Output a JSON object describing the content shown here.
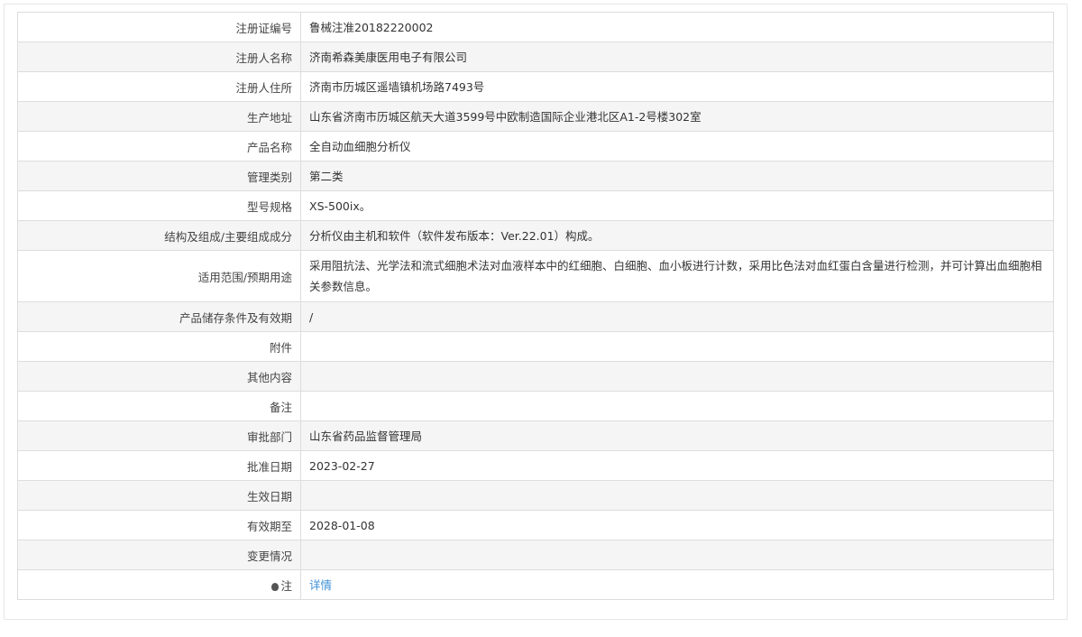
{
  "rows": [
    {
      "label": "注册证编号",
      "value": "鲁械注准20182220002"
    },
    {
      "label": "注册人名称",
      "value": "济南希森美康医用电子有限公司"
    },
    {
      "label": "注册人住所",
      "value": "济南市历城区遥墙镇机场路7493号"
    },
    {
      "label": "生产地址",
      "value": "山东省济南市历城区航天大道3599号中欧制造国际企业港北区A1-2号楼302室"
    },
    {
      "label": "产品名称",
      "value": "全自动血细胞分析仪"
    },
    {
      "label": "管理类别",
      "value": "第二类"
    },
    {
      "label": "型号规格",
      "value": "XS-500ix。"
    },
    {
      "label": "结构及组成/主要组成成分",
      "value": "分析仪由主机和软件（软件发布版本：Ver.22.01）构成。"
    },
    {
      "label": "适用范围/预期用途",
      "value": "采用阻抗法、光学法和流式细胞术法对血液样本中的红细胞、白细胞、血小板进行计数，采用比色法对血红蛋白含量进行检测，并可计算出血细胞相关参数信息。"
    },
    {
      "label": "产品储存条件及有效期",
      "value": "/"
    },
    {
      "label": "附件",
      "value": ""
    },
    {
      "label": "其他内容",
      "value": ""
    },
    {
      "label": "备注",
      "value": ""
    },
    {
      "label": "审批部门",
      "value": "山东省药品监督管理局"
    },
    {
      "label": "批准日期",
      "value": "2023-02-27"
    },
    {
      "label": "生效日期",
      "value": ""
    },
    {
      "label": "有效期至",
      "value": "2028-01-08"
    },
    {
      "label": "变更情况",
      "value": ""
    }
  ],
  "note": {
    "label": "注",
    "link": "详情",
    "icon": "lightbulb-icon"
  }
}
